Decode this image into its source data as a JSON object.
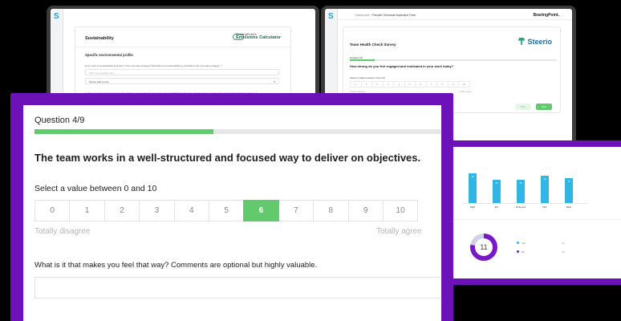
{
  "laptop_left": {
    "brand_letter": "S",
    "section_title": "Sustainability",
    "calculator": {
      "company": "BearingPoint's",
      "product": "Emissions Calculator"
    },
    "subsection_title": "Specific environmental profile",
    "question_1": "How much is sustainability included in the corporate strategy? Describe how sustainability is included in the corporate strategy. *",
    "answer_1_placeholder": "Write your answer here",
    "dropdown_value": "Please add a point",
    "question_2": "Is there an organizational unit in place which is responsible for corporate sustainability? Describe the unit (structure, reporting line and the hierarchical position). *",
    "answer_2_placeholder": "Write your answer here"
  },
  "laptop_right": {
    "brand_letter": "S",
    "breadcrumb": {
      "root": "Dashboard",
      "separator": ">",
      "current": "Periodic Technical Inspection Form"
    },
    "top_brand": "BearingPoint.",
    "survey_title": "Team Health Check Survey",
    "logo_text": "Steerio",
    "question_counter": "Question 1/9",
    "progress": 0.12,
    "question_text": "How strong do you feel engaged and motivated in your work today?",
    "select_label": "Select a value between 0 and 10",
    "scale": [
      "0",
      "1",
      "2",
      "3",
      "4",
      "5",
      "6",
      "7",
      "8",
      "9",
      "10"
    ],
    "low_label": "Totally disagree",
    "high_label": "Totally agree",
    "prev_label": "Prev",
    "next_label": "Next"
  },
  "dashboard": {
    "chart_data": {
      "type": "bar",
      "categories": [
        "DQA",
        "EC",
        "ETH-test",
        "ISG",
        "Wiko"
      ],
      "values": [
        13,
        10,
        10,
        12,
        11
      ],
      "ylim": [
        0,
        14
      ]
    },
    "donut_value": "11",
    "donut_share": 0.78,
    "legend": [
      {
        "label": "Yes",
        "value": "(0)",
        "color": "#2fb6e4"
      },
      {
        "label": "No",
        "value": "(0)",
        "color": "#5b2bb8"
      }
    ]
  },
  "survey": {
    "question_counter": "Question 4/9",
    "progress": 0.44,
    "statement": "The team works in a well-structured and focused way to deliver on objectives.",
    "select_label": "Select a value between 0 and 10",
    "scale": [
      "0",
      "1",
      "2",
      "3",
      "4",
      "5",
      "6",
      "7",
      "8",
      "9",
      "10"
    ],
    "selected_value": "6",
    "low_label": "Totally disagree",
    "high_label": "Totally agree",
    "comment_question": "What is it that makes you feel that way? Comments are optional but highly valuable.",
    "comment_value": ""
  },
  "colors": {
    "frame_purple": "#6c12b8",
    "accent_green": "#63c96d",
    "bar_blue": "#2fb6e4"
  }
}
